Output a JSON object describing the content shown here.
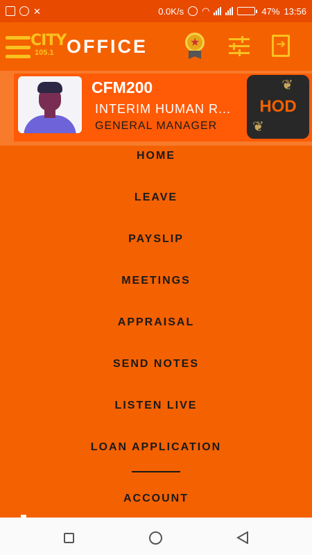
{
  "status_bar": {
    "network_speed": "0.0K/s",
    "battery": "47%",
    "battery_level": 0.47,
    "time": "13:56"
  },
  "app_bar": {
    "logo_text": "CITY",
    "logo_frequency": "105.1",
    "title": "OFFICE",
    "actions": [
      "badge-icon",
      "tune-icon",
      "logout-icon"
    ]
  },
  "profile": {
    "code": "CFM200",
    "department": "INTERIM HUMAN R...",
    "role": "GENERAL MANAGER",
    "badge": "HOD"
  },
  "menu": {
    "items": [
      "HOME",
      "LEAVE",
      "PAYSLIP",
      "MEETINGS",
      "APPRAISAL",
      "SEND NOTES",
      "LISTEN LIVE",
      "LOAN APPLICATION"
    ],
    "section_after_divider": "ACCOUNT"
  },
  "colors": {
    "primary": "#f46100",
    "accent": "#f9c21f",
    "profile_bg": "#ff5a05"
  }
}
